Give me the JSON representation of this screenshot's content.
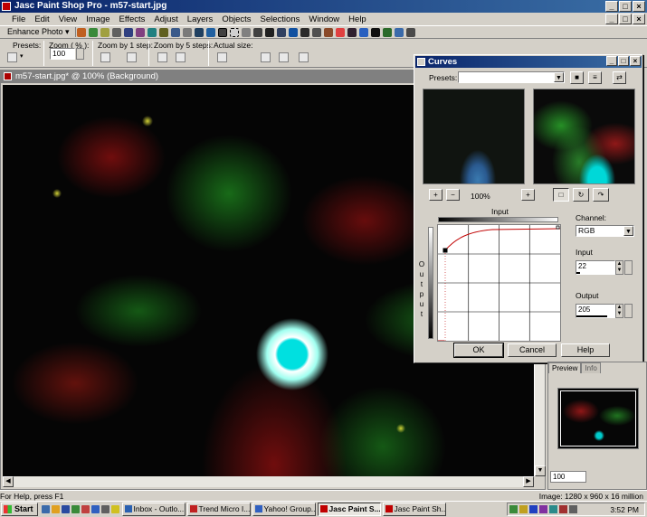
{
  "app": {
    "title": "Jasc Paint Shop Pro - m57-start.jpg",
    "window_buttons": [
      "_",
      "□",
      "×"
    ]
  },
  "menu": [
    "File",
    "Edit",
    "View",
    "Image",
    "Effects",
    "Adjust",
    "Layers",
    "Objects",
    "Selections",
    "Window",
    "Help"
  ],
  "toolbar": {
    "enhance_label": "Enhance Photo ▾"
  },
  "options": {
    "presets_label": "Presets:",
    "zoom_label": "Zoom ( % ):",
    "zoom_value": "100",
    "zoom_step1_label": "Zoom by 1 step:",
    "zoom_step5_label": "Zoom by 5 steps:",
    "actual_size_label": "Actual size:"
  },
  "document": {
    "title": "m57-start.jpg* @ 100% (Background)"
  },
  "curves": {
    "title": "Curves",
    "presets_label": "Presets:",
    "zoom_level": "100%",
    "input_label": "Input",
    "output_label": "O u t p u t",
    "channel_label": "Channel:",
    "channel_value": "RGB",
    "input_field_label": "Input",
    "input_value": "22",
    "output_field_label": "Output",
    "output_value": "205",
    "ok_label": "OK",
    "cancel_label": "Cancel",
    "help_label": "Help"
  },
  "overview": {
    "tab_preview": "Preview",
    "tab_info": "Info",
    "zoom_value": "100"
  },
  "status": {
    "help_text": "For Help, press F1",
    "image_info": "Image: 1280 x 960 x 16 million"
  },
  "taskbar": {
    "start_label": "Start",
    "tasks": [
      "Inbox - Outlo...",
      "Trend Micro I...",
      "Yahoo! Group...",
      "Jasc Paint S...",
      "Jasc Paint Sh..."
    ],
    "clock": "3:52 PM"
  },
  "colors": {
    "title_active": "#0a246a",
    "title_active_end": "#3a6ea5",
    "face": "#d4d0c8",
    "curve": "#c00000"
  }
}
